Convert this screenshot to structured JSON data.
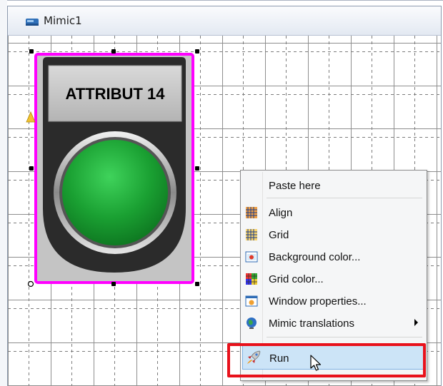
{
  "window": {
    "title": "Mimic1",
    "icon": "mimic-window-icon"
  },
  "pushbutton": {
    "label": "ATTRIBUT 14",
    "button_color": "#1aa032",
    "selection_color": "#ff00ff"
  },
  "context_menu": {
    "items": [
      {
        "label": "Paste here",
        "icon": ""
      },
      {
        "label": "Align",
        "icon": "align-icon"
      },
      {
        "label": "Grid",
        "icon": "grid-icon"
      },
      {
        "label": "Background color...",
        "icon": "background-color-icon"
      },
      {
        "label": "Grid color...",
        "icon": "grid-color-icon"
      },
      {
        "label": "Window properties...",
        "icon": "window-properties-icon"
      },
      {
        "label": "Mimic translations",
        "icon": "globe-icon",
        "submenu": true
      },
      {
        "label": "Run",
        "icon": "rocket-icon",
        "highlighted": true
      }
    ]
  },
  "colors": {
    "highlight_border": "#e8111b",
    "menu_hover": "#cce4f7"
  }
}
